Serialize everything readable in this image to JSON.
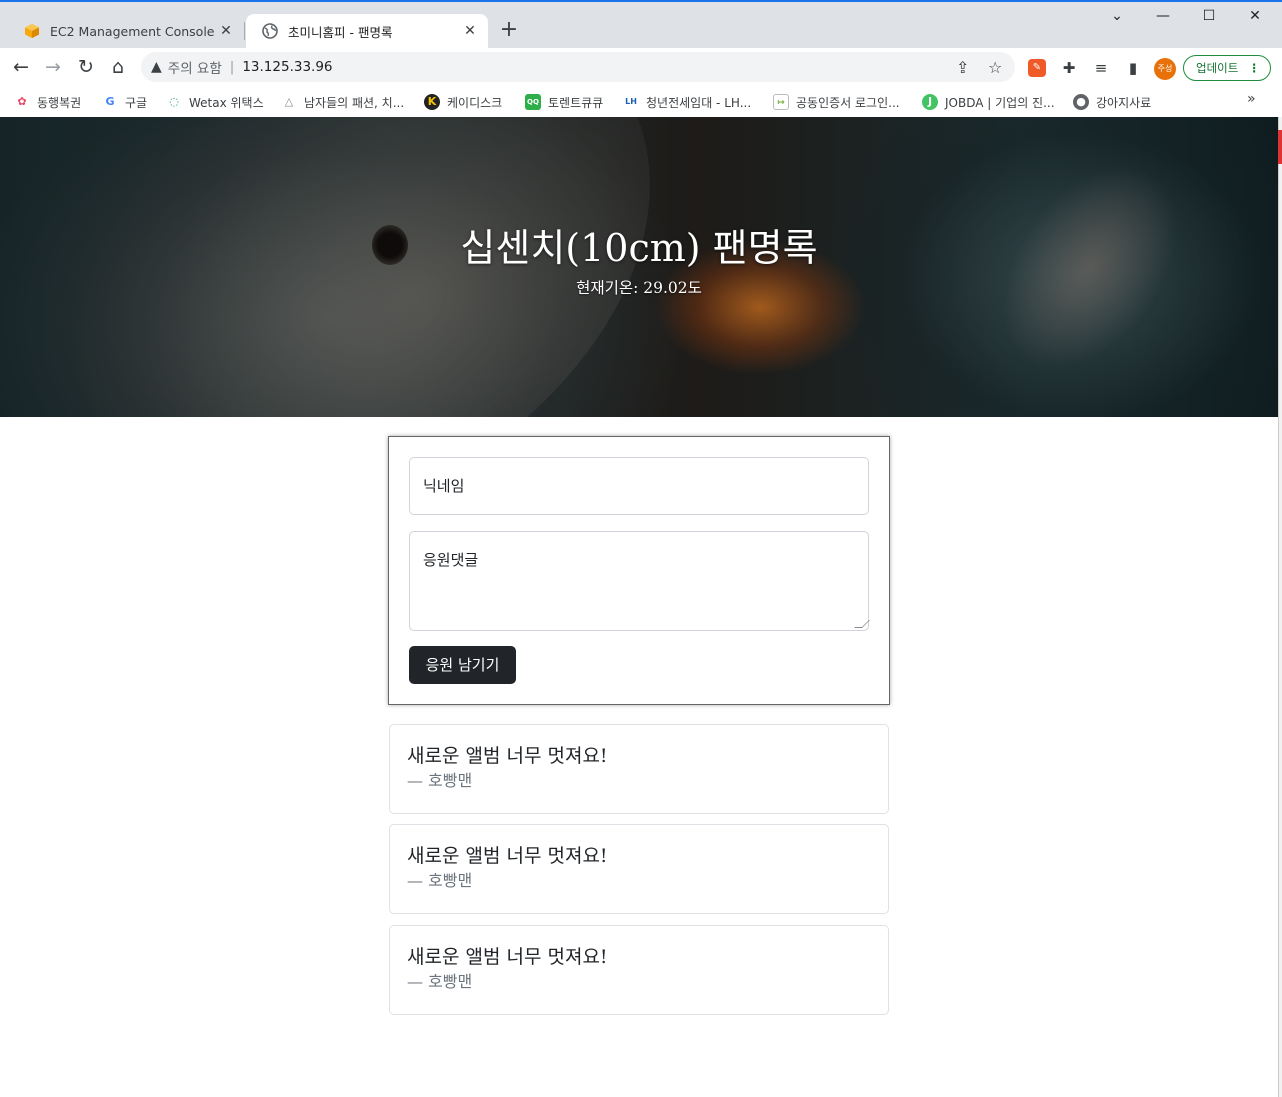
{
  "browser": {
    "tabs": [
      {
        "title": "EC2 Management Console",
        "active": false
      },
      {
        "title": "초미니홈피 - 팬명록",
        "active": true
      }
    ],
    "new_tab": "+",
    "omnibox": {
      "security_label": "주의 요함",
      "url": "13.125.33.96"
    },
    "profile_label": "주성",
    "update_label": "업데이트",
    "bookmarks": [
      {
        "label": "동행복권",
        "icon": "lottery-icon",
        "color": "#e94560"
      },
      {
        "label": "구글",
        "icon": "google-icon",
        "color": "#4285f4"
      },
      {
        "label": "Wetax 위택스",
        "icon": "wetax-icon",
        "color": "#1fa05b"
      },
      {
        "label": "남자들의 패션, 치...",
        "icon": "fashion-icon",
        "color": "#888888"
      },
      {
        "label": "케이디스크",
        "icon": "kdisk-icon",
        "color": "#f5c400"
      },
      {
        "label": "토렌트큐큐",
        "icon": "torrent-icon",
        "color": "#2eaf4a"
      },
      {
        "label": "청년전세임대 - LH...",
        "icon": "lh-icon",
        "color": "#1a5fb4"
      },
      {
        "label": "공동인증서 로그인...",
        "icon": "cert-icon",
        "color": "#7cb342"
      },
      {
        "label": "JOBDA | 기업의 진...",
        "icon": "jobda-icon",
        "color": "#43c463"
      },
      {
        "label": "강아지사료",
        "icon": "globe-icon",
        "color": "#5f6368"
      }
    ],
    "more_bookmarks": "»"
  },
  "page": {
    "title": "십센치(10cm) 팬명록",
    "weather": "현재기온: 29.02도",
    "form": {
      "name_placeholder": "닉네임",
      "comment_placeholder": "응원댓글",
      "submit_label": "응원 남기기"
    },
    "comments": [
      {
        "message": "새로운 앨범 너무 멋져요!",
        "author": "— 호빵맨"
      },
      {
        "message": "새로운 앨범 너무 멋져요!",
        "author": "— 호빵맨"
      },
      {
        "message": "새로운 앨범 너무 멋져요!",
        "author": "— 호빵맨"
      }
    ]
  }
}
